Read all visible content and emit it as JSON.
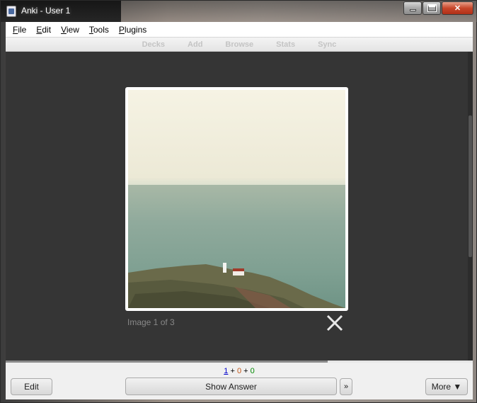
{
  "window": {
    "title": "Anki - User 1",
    "controls": {
      "minimize": "minimize",
      "maximize": "maximize",
      "close": "✕"
    }
  },
  "menubar": [
    {
      "key": "F",
      "rest": "ile",
      "label": "File"
    },
    {
      "key": "E",
      "rest": "dit",
      "label": "Edit"
    },
    {
      "key": "V",
      "rest": "iew",
      "label": "View"
    },
    {
      "key": "T",
      "rest": "ools",
      "label": "Tools"
    },
    {
      "key": "P",
      "rest": "lugins",
      "label": "Plugins"
    }
  ],
  "toolbar": {
    "decks": "Decks",
    "add": "Add",
    "browse": "Browse",
    "stats": "Stats",
    "sync": "Sync"
  },
  "reviewer": {
    "caption": "Image 1 of 3",
    "close_icon": "close-x-icon"
  },
  "progress": {
    "fraction": 0.69
  },
  "counts": {
    "new": "1",
    "learn": "0",
    "review": "0",
    "plus": "+"
  },
  "buttons": {
    "edit": "Edit",
    "show_answer": "Show Answer",
    "more_arrow": "»",
    "more": "More ▼"
  },
  "colors": {
    "reviewer_bg": "#353535",
    "count_new": "#0000cc",
    "count_learn": "#c35617",
    "count_review": "#008800"
  }
}
